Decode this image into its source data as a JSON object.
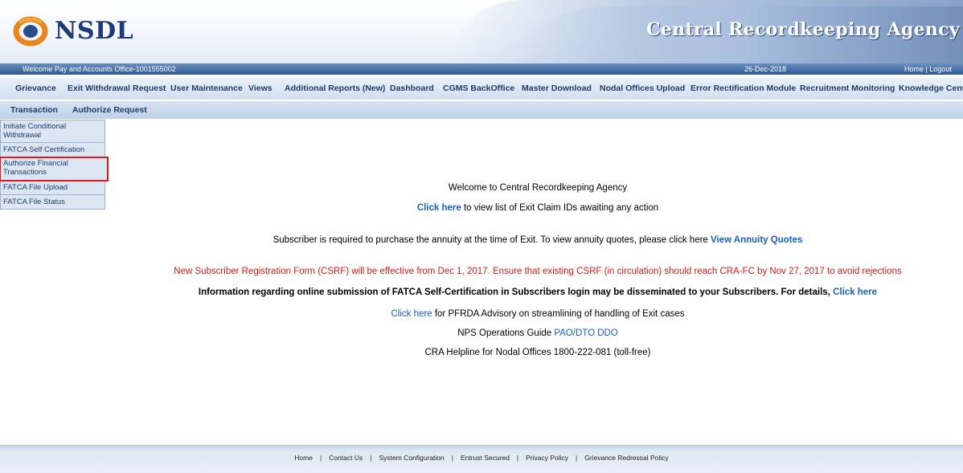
{
  "header": {
    "logo_text": "NSDL",
    "title": "Central Recordkeeping Agency"
  },
  "welcome_bar": {
    "welcome": "Welcome Pay and Accounts Office-1001555002",
    "date": "26-Dec-2018",
    "home": "Home",
    "separator": " | ",
    "logout": "Logout"
  },
  "menu": {
    "items": [
      "Grievance",
      "Exit Withdrawal Request",
      "User Maintenance",
      "Views",
      "Additional Reports (New)",
      "Dashboard",
      "CGMS BackOffice",
      "Master Download",
      "Nodal Offices Upload",
      "Error Rectification Module",
      "Recruitment Monitoring",
      "Knowledge Centre"
    ]
  },
  "submenu": {
    "items": [
      "Transaction",
      "Authorize Request"
    ]
  },
  "side_menu": {
    "items": [
      "Initiate Conditional Withdrawal",
      "FATCA Self Certification",
      "Authorize Financial Transactions",
      "FATCA File Upload",
      "FATCA File Status"
    ],
    "highlight_color": "#e0191c"
  },
  "content": {
    "welcome": "Welcome to Central Recordkeeping Agency",
    "exit_link": "Click here",
    "exit_text": " to view list of Exit Claim IDs awaiting any action",
    "annuity_text": "Subscriber is required to purchase the annuity at the time of Exit. To view annuity quotes, please click here ",
    "annuity_link": "View Annuity Quotes",
    "csrf_notice": "New Subscriber Registration Form (CSRF) will be effective from Dec 1, 2017. Ensure that existing CSRF (in circulation) should reach CRA-FC by Nov 27, 2017 to avoid rejections",
    "fatca_text": "Information regarding online submission of FATCA Self-Certification in Subscribers login may be disseminated to your Subscribers. For details, ",
    "fatca_link": "Click here",
    "pfrda_link": "Click here",
    "pfrda_text": " for PFRDA Advisory on streamlining of handling of Exit cases",
    "ops_text": "NPS Operations Guide ",
    "ops_link": "PAO/DTO DDO",
    "helpline": "CRA Helpline for Nodal Offices 1800-222-081 (toll-free)"
  },
  "footer": {
    "links": [
      "Home",
      "Contact Us",
      "System Configuration",
      "Entrust Secured",
      "Privacy Policy",
      "Grievance Redressal Policy"
    ],
    "separator": "|"
  },
  "colors": {
    "link": "#1a5fc8",
    "notice_red": "#e01818",
    "menu_text": "#1d3d6e",
    "bar_blue": "#2f5a94"
  }
}
